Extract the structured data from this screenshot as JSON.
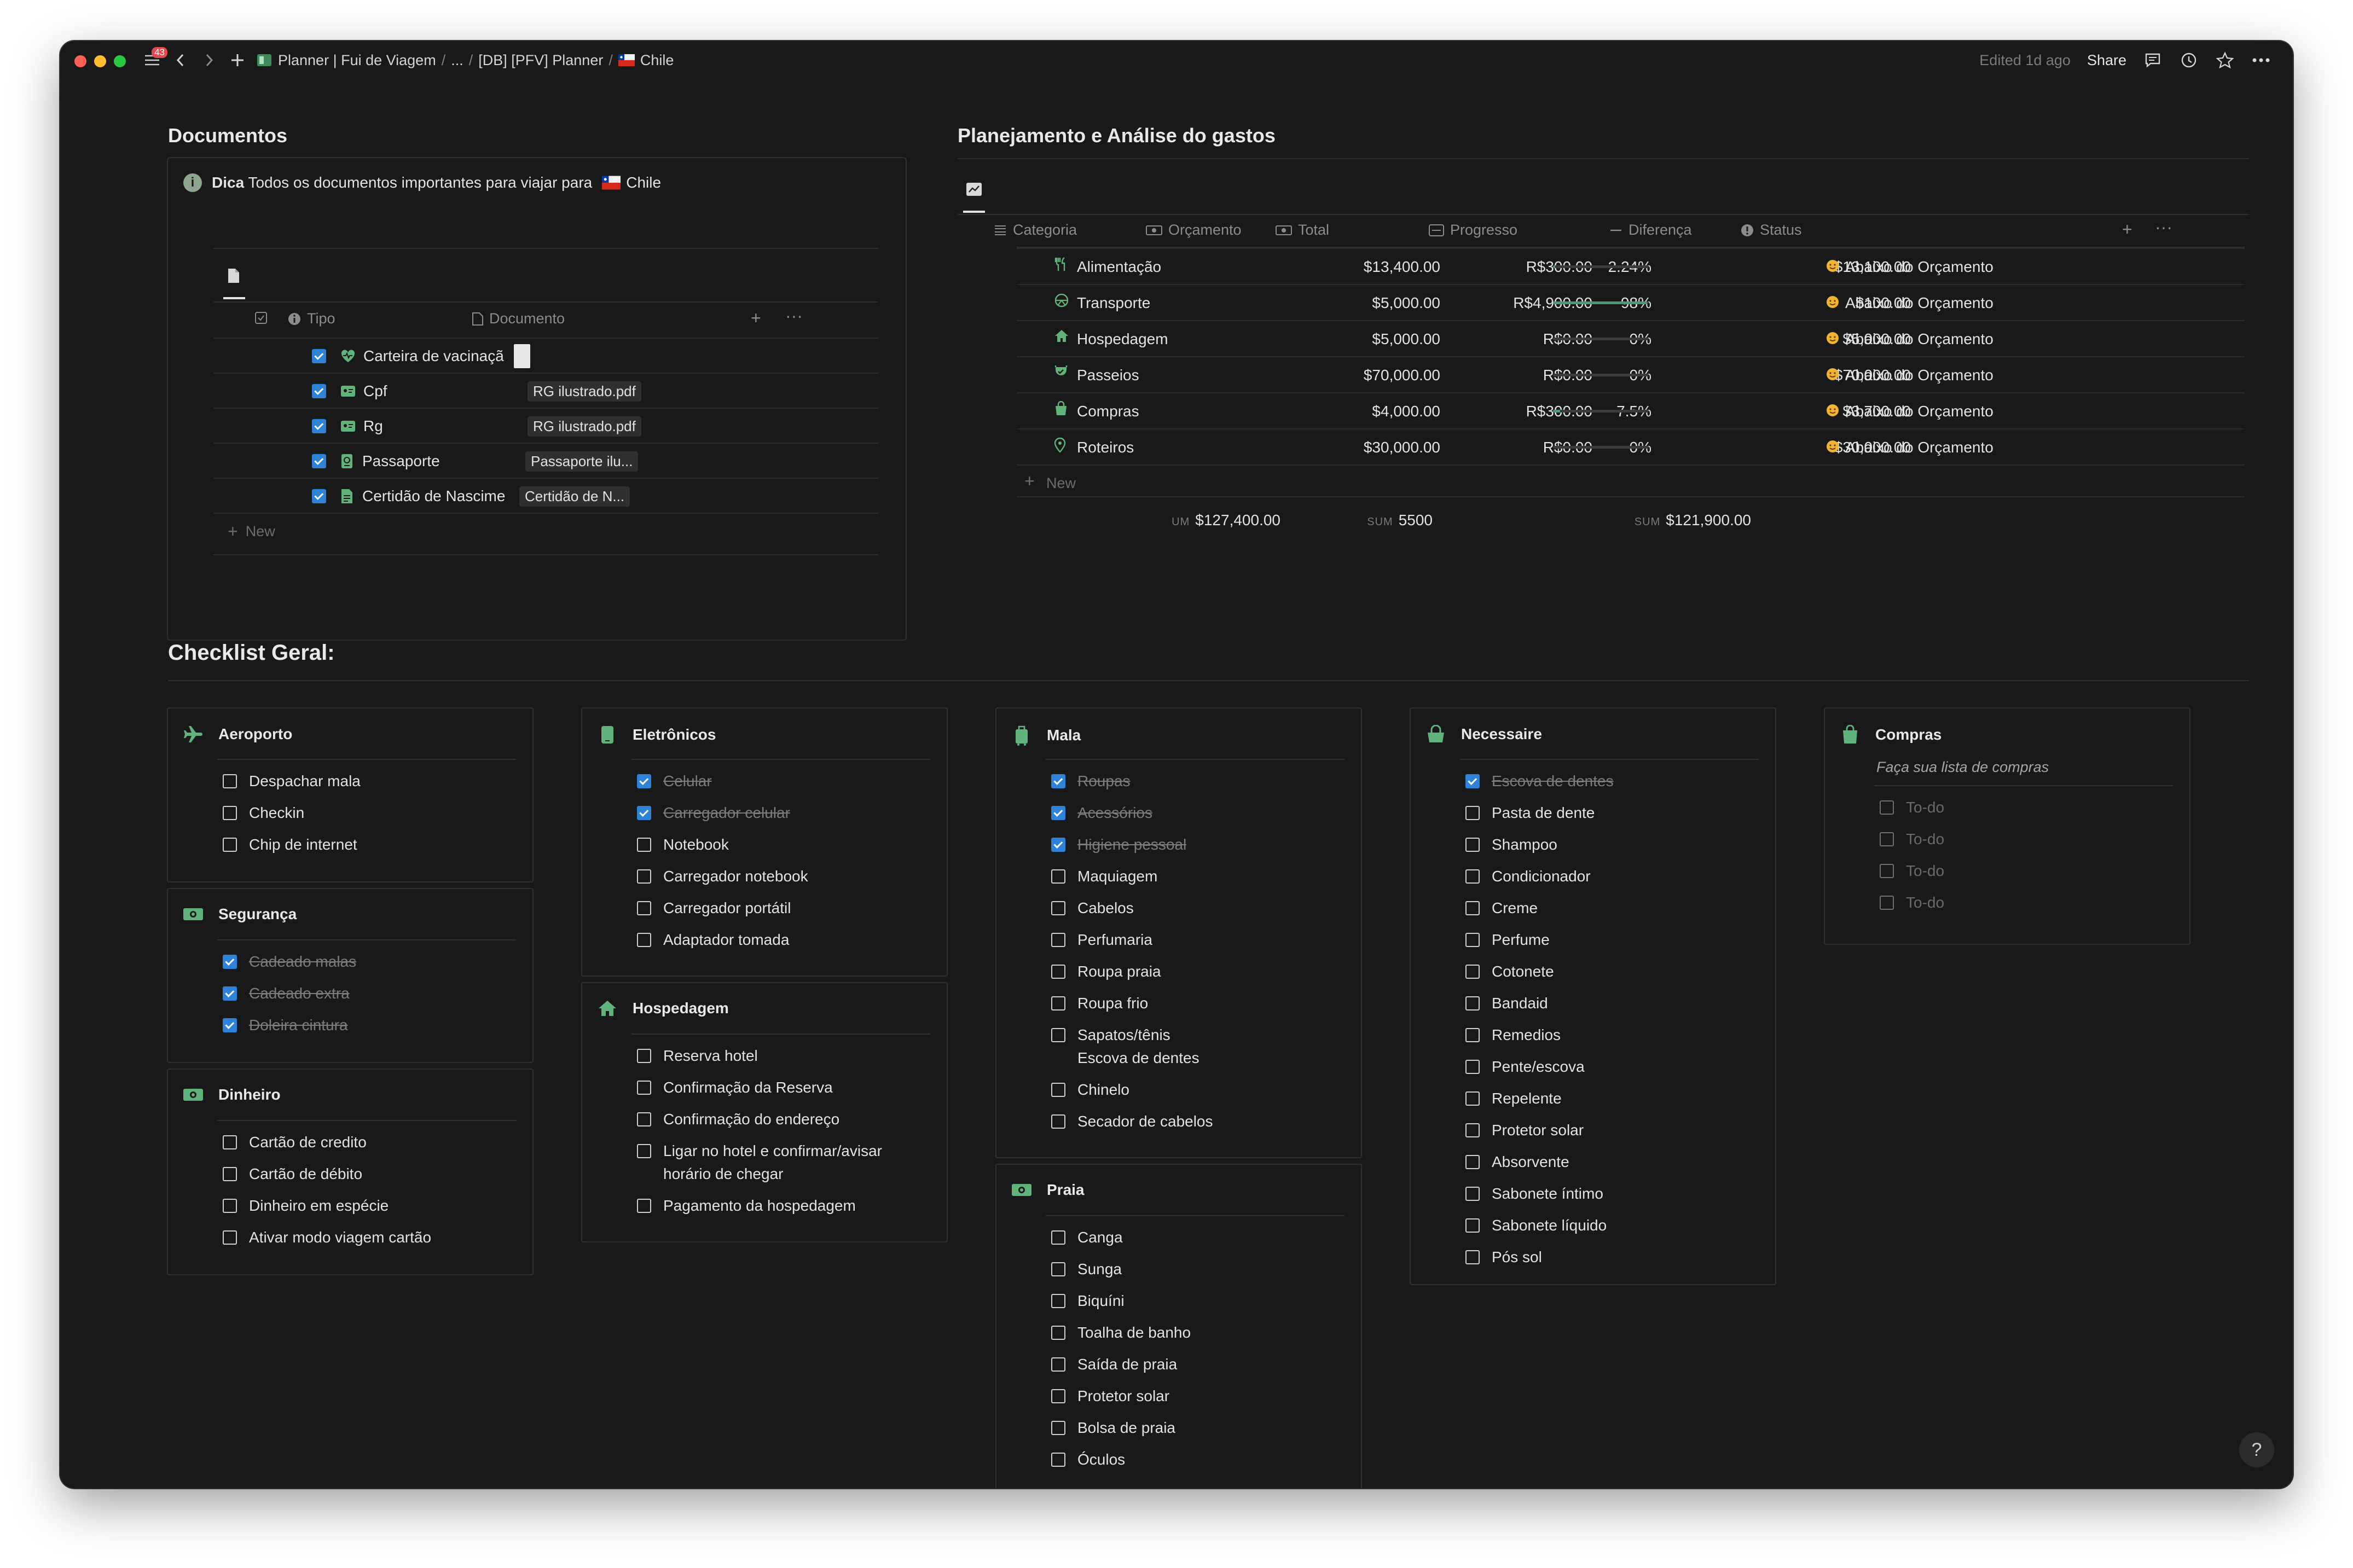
{
  "titlebar": {
    "badge": "43",
    "crumbs": [
      "Planner | Fui de Viagem",
      "...",
      "[DB] [PFV] Planner",
      "Chile"
    ],
    "edited": "Edited 1d ago",
    "share": "Share"
  },
  "colors": {
    "accent_green": "#5fb37b",
    "checkbox_blue": "#2e83d8",
    "bg": "#191919"
  },
  "documentos": {
    "title": "Documentos",
    "callout_bold": "Dica",
    "callout_text": "Todos os documentos importantes para viajar para",
    "callout_dest": "Chile",
    "col_tipo": "Tipo",
    "col_documento": "Documento",
    "rows": [
      {
        "tipo": "Carteira de vacinaçã",
        "doc": ""
      },
      {
        "tipo": "Cpf",
        "doc": "RG ilustrado.pdf"
      },
      {
        "tipo": "Rg",
        "doc": "RG ilustrado.pdf"
      },
      {
        "tipo": "Passaporte",
        "doc": "Passaporte ilu..."
      },
      {
        "tipo": "Certidão de Nascime",
        "doc": "Certidão de N..."
      }
    ],
    "new_label": "New"
  },
  "planejamento": {
    "title": "Planejamento e Análise do gastos",
    "cols": [
      "Categoria",
      "Orçamento",
      "Total",
      "Progresso",
      "Diferença",
      "Status"
    ],
    "rows": [
      {
        "cat": "Alimentação",
        "orc": "$13,400.00",
        "total": "R$300.00",
        "prog": "2.24%",
        "prog_value": 2.24,
        "dif": "$13,100.00",
        "status": "Abaixo do Orçamento"
      },
      {
        "cat": "Transporte",
        "orc": "$5,000.00",
        "total": "R$4,900.00",
        "prog": "98%",
        "prog_value": 98,
        "dif": "$100.00",
        "status": "Abaixo do Orçamento"
      },
      {
        "cat": "Hospedagem",
        "orc": "$5,000.00",
        "total": "R$0.00",
        "prog": "0%",
        "prog_value": 0,
        "dif": "$5,000.00",
        "status": "Abaixo do Orçamento"
      },
      {
        "cat": "Passeios",
        "orc": "$70,000.00",
        "total": "R$0.00",
        "prog": "0%",
        "prog_value": 0,
        "dif": "$70,000.00",
        "status": "Abaixo do Orçamento"
      },
      {
        "cat": "Compras",
        "orc": "$4,000.00",
        "total": "R$300.00",
        "prog": "7.5%",
        "prog_value": 7.5,
        "dif": "$3,700.00",
        "status": "Abaixo do Orçamento"
      },
      {
        "cat": "Roteiros",
        "orc": "$30,000.00",
        "total": "R$0.00",
        "prog": "0%",
        "prog_value": 0,
        "dif": "$30,000.00",
        "status": "Abaixo do Orçamento"
      }
    ],
    "new_label": "New",
    "sum_orc_label": "UM",
    "sum_orc": "$127,400.00",
    "sum_total_label": "SUM",
    "sum_total": "5500",
    "sum_dif_label": "SUM",
    "sum_dif": "$121,900.00"
  },
  "checklist": {
    "title": "Checklist Geral:",
    "aeroporto": {
      "title": "Aeroporto",
      "items": [
        "Despachar mala",
        "Checkin",
        "Chip de internet"
      ]
    },
    "seguranca": {
      "title": "Segurança",
      "items": [
        "Cadeado malas",
        "Cadeado extra",
        "Doleira cintura"
      ]
    },
    "dinheiro": {
      "title": "Dinheiro",
      "items": [
        "Cartão de credito",
        "Cartão de débito",
        "Dinheiro em espécie",
        "Ativar modo viagem cartão"
      ]
    },
    "eletronicos": {
      "title": "Eletrônicos",
      "items": [
        "Celular",
        "Carregador celular",
        "Notebook",
        "Carregador notebook",
        "Carregador portátil",
        "Adaptador tomada"
      ]
    },
    "hospedagem": {
      "title": "Hospedagem",
      "items": [
        "Reserva hotel",
        "Confirmação da Reserva",
        "Confirmação do endereço",
        "Ligar no hotel e confirmar/avisar",
        "horário de chegar",
        "Pagamento da hospedagem"
      ]
    },
    "mala": {
      "title": "Mala",
      "items": [
        "Roupas",
        "Acessórios",
        "Higiene pessoal",
        "Maquiagem",
        "Cabelos",
        "Perfumaria",
        "Roupa praia",
        "Roupa frio",
        "Sapatos/tênis",
        "Escova de dentes",
        "Chinelo",
        "Secador de cabelos"
      ]
    },
    "praia": {
      "title": "Praia",
      "items": [
        "Canga",
        "Sunga",
        "Biquíni",
        "Toalha de banho",
        "Saída de praia",
        "Protetor solar",
        "Bolsa de praia",
        "Óculos"
      ]
    },
    "necessaire": {
      "title": "Necessaire",
      "items": [
        "Escova de dentes",
        "Pasta de dente",
        "Shampoo",
        "Condicionador",
        "Creme",
        "Perfume",
        "Cotonete",
        "Bandaid",
        "Remedios",
        "Pente/escova",
        "Repelente",
        "Protetor solar",
        "Absorvente",
        "Sabonete íntimo",
        "Sabonete líquido",
        "Pós sol"
      ]
    },
    "compras": {
      "title": "Compras",
      "subtitle": "Faça sua lista de compras",
      "items": [
        "To-do",
        "To-do",
        "To-do",
        "To-do"
      ]
    }
  },
  "help": "?"
}
